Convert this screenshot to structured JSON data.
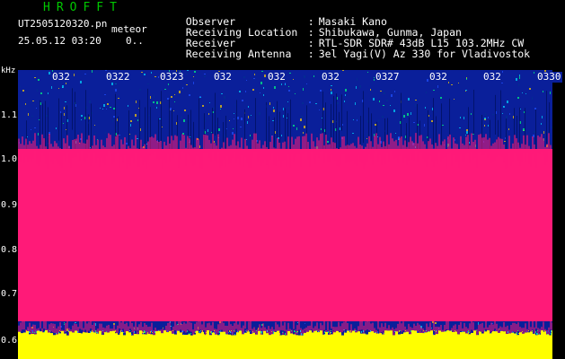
{
  "header": {
    "app_title": "HROFFT",
    "file_name": "UT2505120320.pn",
    "mode": "meteor",
    "datetime": "25.05.12 03:20",
    "counter": "0.."
  },
  "info": {
    "separator": ":",
    "observer_label": "Observer",
    "observer_value": "Masaki Kano",
    "location_label": "Receiving Location",
    "location_value": "Shibukawa, Gunma, Japan",
    "receiver_label": "Receiver",
    "receiver_value": "RTL-SDR SDR# 43dB L15 103.2MHz CW",
    "antenna_label": "Receiving Antenna",
    "antenna_value": "3el Yagi(V) Az 330 for Vladivostok"
  },
  "axes": {
    "y_unit": "kHz",
    "y_ticks": [
      "1.1",
      "1.0",
      "0.9",
      "0.8",
      "0.7",
      "0.6"
    ],
    "x_ticks": [
      "032",
      "0322",
      "0323",
      "032",
      "032",
      "032",
      "0327",
      "032",
      "032",
      "0330"
    ]
  },
  "colors": {
    "background": "#000000",
    "spectrogram_noise": "#0a1f9a",
    "signal_band": "#ff1a78",
    "baseline": "#ffff00",
    "title": "#00c800"
  }
}
